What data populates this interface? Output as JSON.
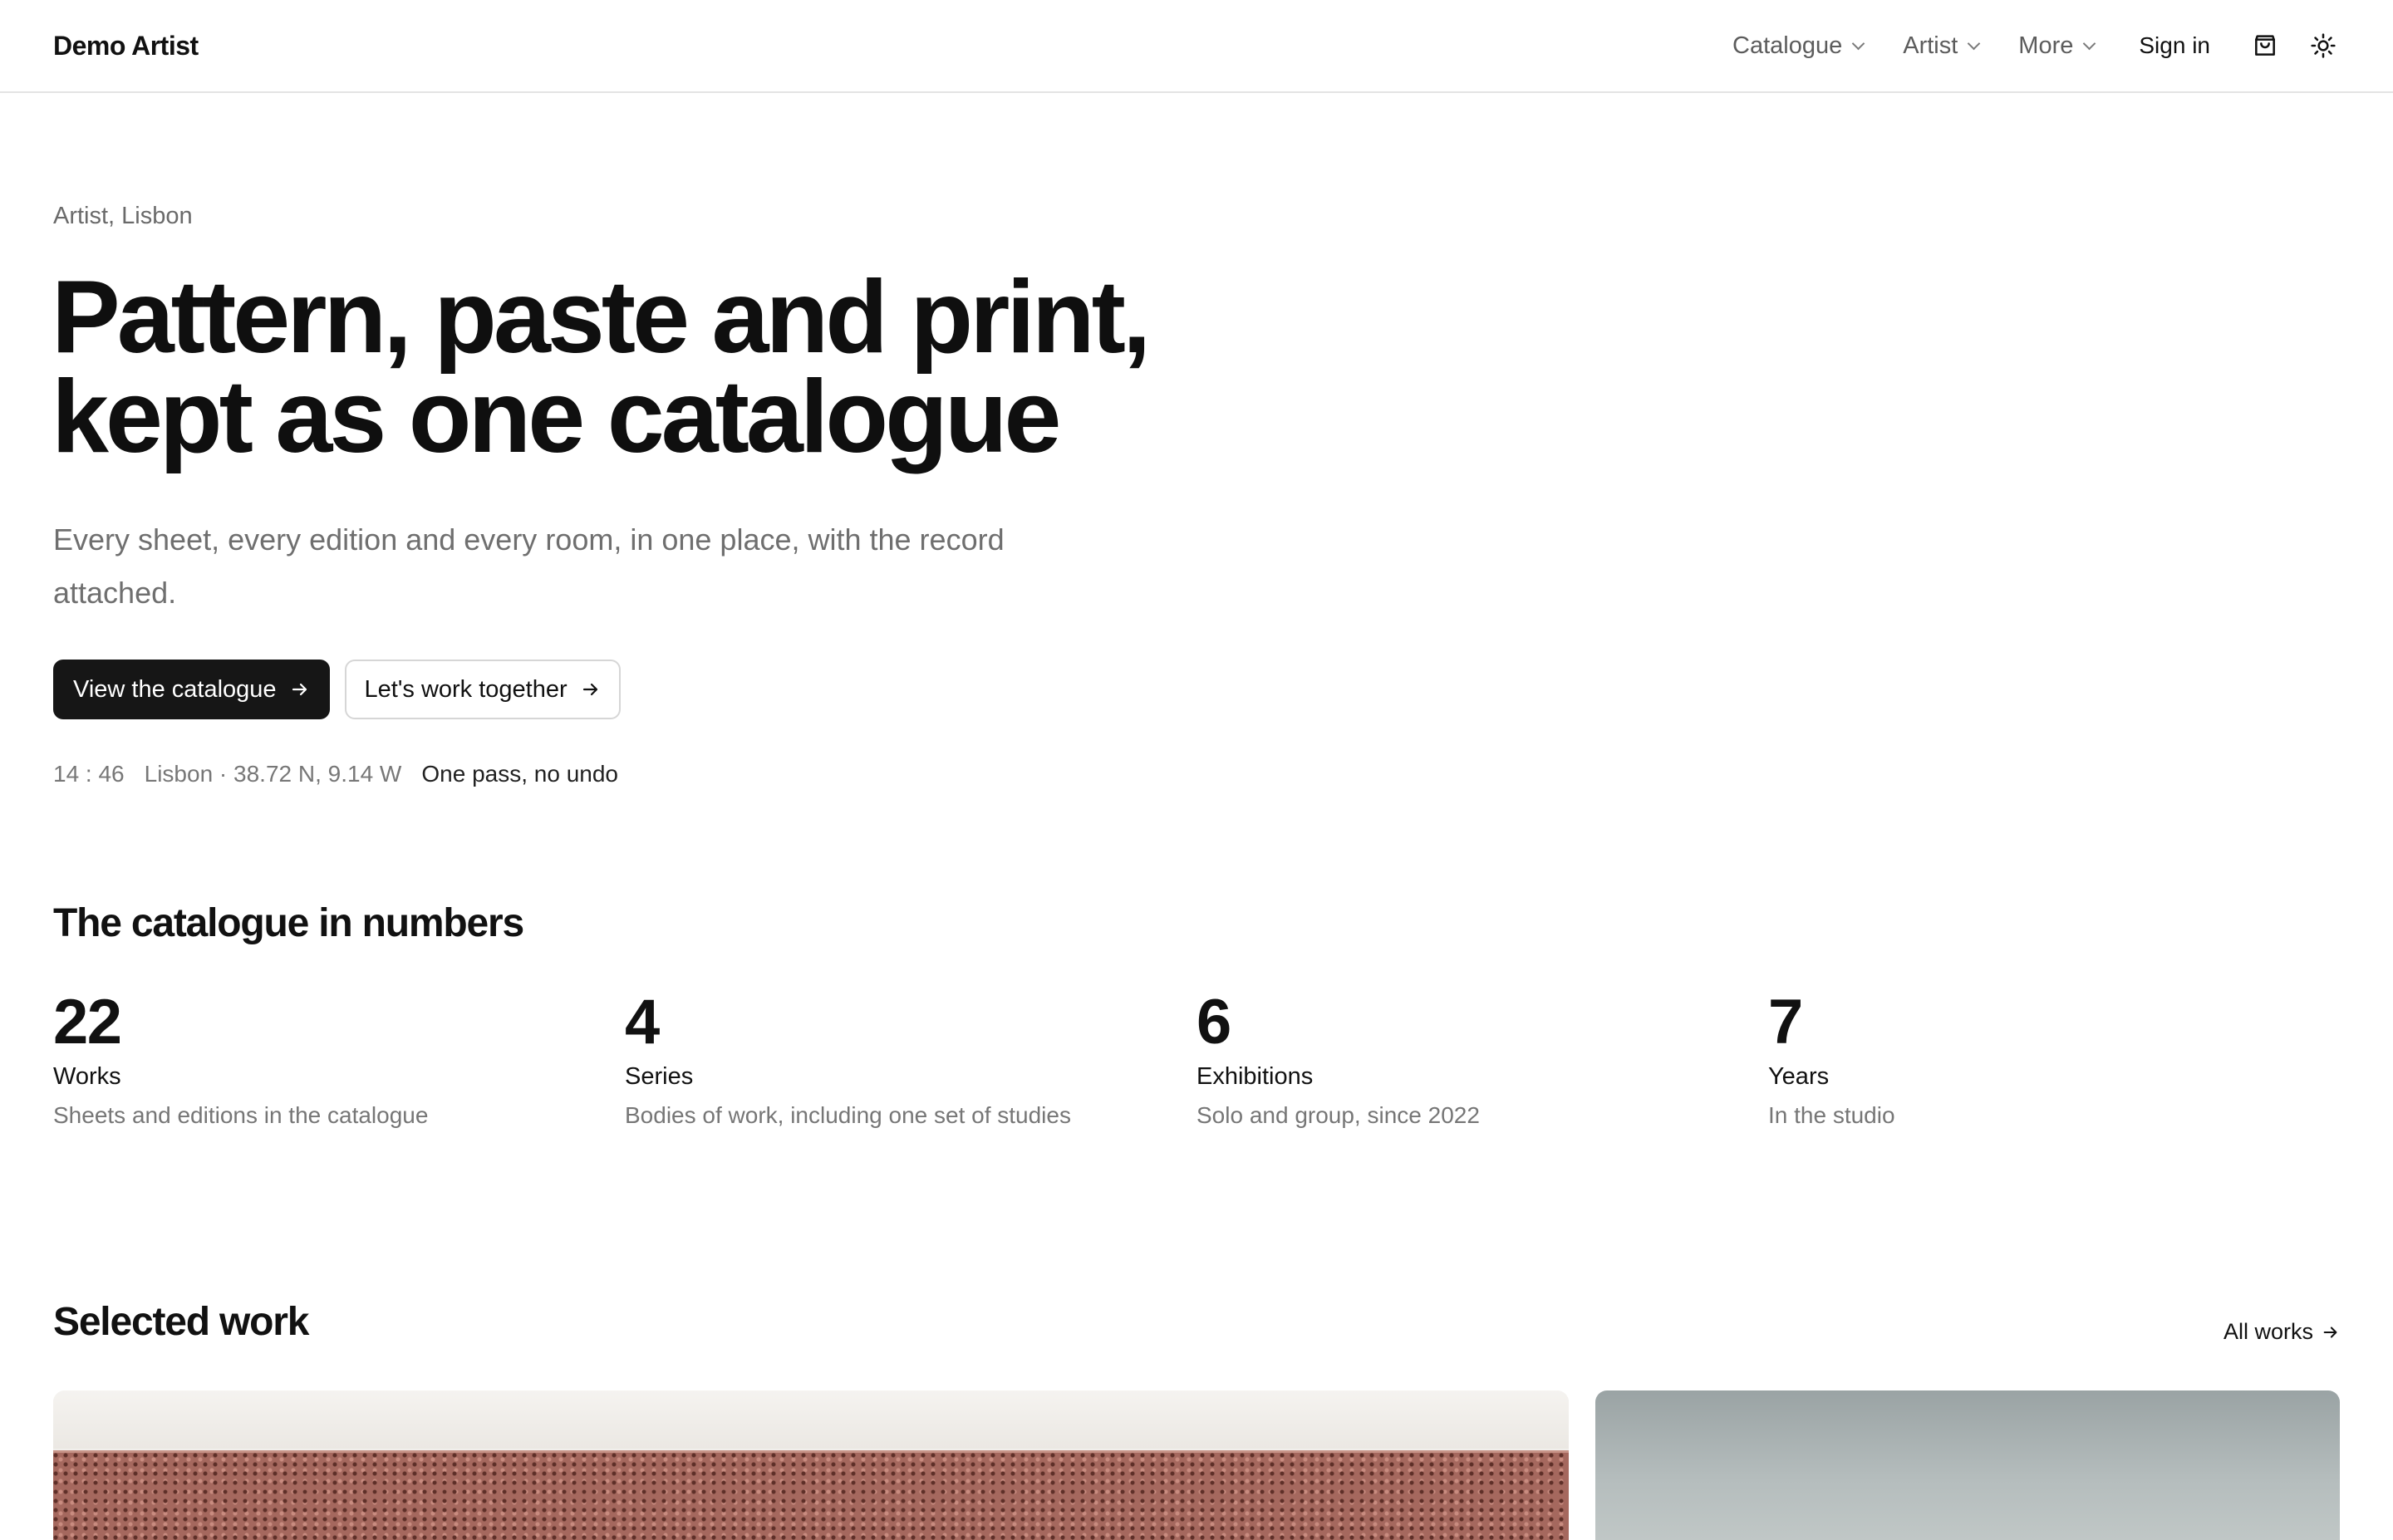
{
  "header": {
    "brand": "Demo Artist",
    "nav": [
      {
        "label": "Catalogue"
      },
      {
        "label": "Artist"
      },
      {
        "label": "More"
      }
    ],
    "signin": "Sign in",
    "icons": [
      "shopping-bag-icon",
      "sun-icon"
    ]
  },
  "hero": {
    "eyebrow": "Artist, Lisbon",
    "title_line1": "Pattern, paste and print,",
    "title_line2": "kept as one catalogue",
    "subtitle": "Every sheet, every edition and every room, in one place, with the record attached.",
    "primary_cta": "View the catalogue",
    "secondary_cta": "Let's work together",
    "meta_time": "14 : 46",
    "meta_location": "Lisbon · 38.72 N, 9.14 W",
    "meta_note": "One pass, no undo"
  },
  "numbers": {
    "title": "The catalogue in numbers",
    "stats": [
      {
        "value": "22",
        "label": "Works",
        "desc": "Sheets and editions in the catalogue"
      },
      {
        "value": "4",
        "label": "Series",
        "desc": "Bodies of work, including one set of studies"
      },
      {
        "value": "6",
        "label": "Exhibitions",
        "desc": "Solo and group, since 2022"
      },
      {
        "value": "7",
        "label": "Years",
        "desc": "In the studio"
      }
    ]
  },
  "selected": {
    "title": "Selected work",
    "all_link": "All works"
  },
  "colors": {
    "primary_button": "#161616",
    "text": "#111111",
    "muted": "#6f6f6f",
    "border": "#e4e4e4"
  }
}
